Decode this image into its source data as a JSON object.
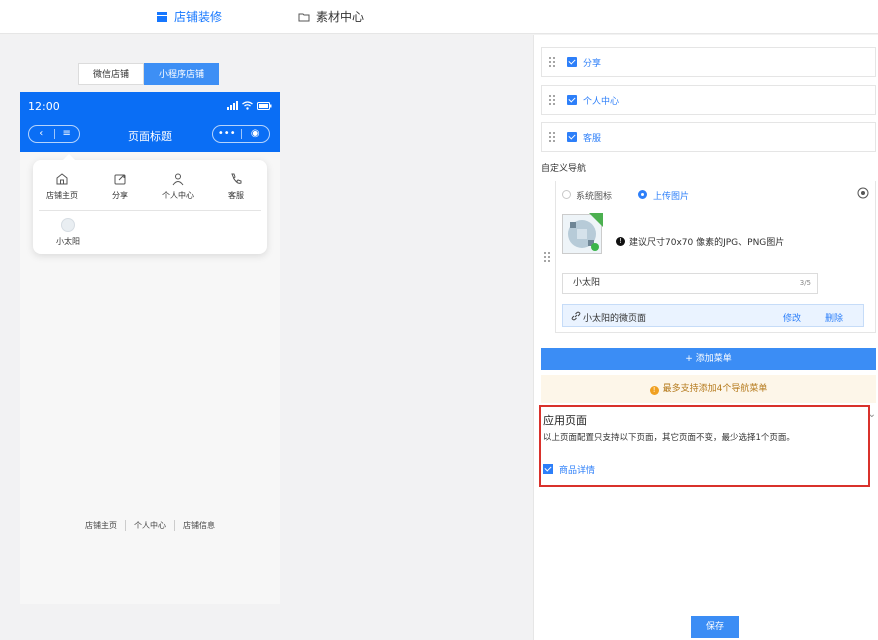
{
  "topbar": {
    "store_decor": "店铺装修",
    "media_center": "素材中心"
  },
  "preview": {
    "segment": [
      "微信店铺",
      "小程序店铺"
    ],
    "active_segment": 1,
    "time": "12:00",
    "page_title": "页面标题",
    "popup_items": [
      "店铺主页",
      "分享",
      "个人中心",
      "客服"
    ],
    "custom_item": "小太阳",
    "footer_links": [
      "店铺主页",
      "个人中心",
      "店铺信息"
    ]
  },
  "panel": {
    "menu_rows": [
      "分享",
      "个人中心",
      "客服"
    ],
    "custom_nav_title": "自定义导航",
    "radio_system": "系统图标",
    "radio_upload": "上传图片",
    "size_hint": "建议尺寸70x70 像素的JPG、PNG图片",
    "name_value": "小太阳",
    "name_count": "3/5",
    "link_text": "小太阳的微页面",
    "edit": "修改",
    "delete": "删除",
    "add_menu": "+ 添加菜单",
    "limit_warning": "最多支持添加4个导航菜单",
    "app_pages_title": "应用页面",
    "app_pages_desc": "以上页面配置只支持以下页面，其它页面不变，最少选择1个页面。",
    "product_detail": "商品详情",
    "save": "保存"
  },
  "colors": {
    "accent": "#2d7ff9",
    "phone_header": "#0a6ef5",
    "highlight_border": "#d9312b"
  }
}
